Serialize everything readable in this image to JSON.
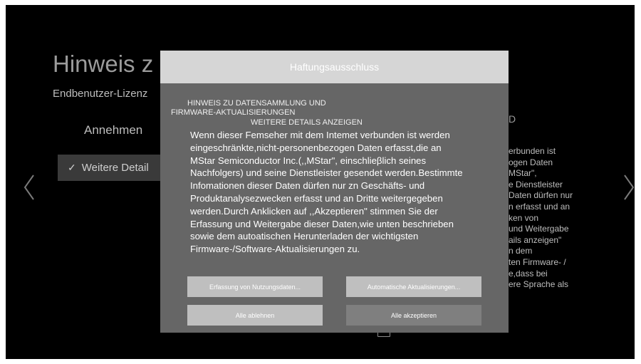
{
  "background": {
    "title": "Hinweis z",
    "subtitle": "Endbenutzer-Lizenz",
    "accept_option": "Annehmen",
    "more_details_option": "Weitere Detail",
    "right_panel_heading": "D",
    "right_panel_lines": [
      "erbunden ist",
      "ogen Daten",
      "MStar\",",
      "e Dienstleister",
      "Daten dürfen nur",
      "n erfasst und an",
      "ken von",
      "und Weitergabe",
      "ails anzeigen\"",
      "n dem",
      "ten Firmware- /",
      "e,dass bei",
      "ere Sprache als"
    ],
    "left_arrow_icon": "chevron-left-icon",
    "right_arrow_icon": "chevron-right-icon",
    "bottom_icon": "document-icon"
  },
  "modal": {
    "title": "Haftungsausschluss",
    "hinweis_lines": [
      "HINWEIS ZU DATENSAMMLUNG UND",
      "FIRMWARE-AKTUALISIERUNGEN"
    ],
    "more_details_link": "WEITERE DETAILS ANZEIGEN",
    "body_lines": [
      "Wenn dieser Femseher mit dem Intemet verbunden ist werden",
      "eingeschränkte,nicht-personenbezogen Daten erfasst,die an",
      "MStar Semiconductor Inc.(,,MStar\", einschlieβlich seines",
      "Nachfolgers) und seine Dienstleister gesendet werden.Bestimmte",
      "Infomationen dieser Daten dürfen nur zn Geschäfts- und",
      "Produktanalysezwecken erfasst und an Dritte weitergegeben",
      "werden.Durch Anklicken auf ,,Akzeptieren\" stimmen Sie der",
      "Erfassung und Weitergabe dieser Daten,wie unten beschrieben",
      "sowie dem autoatischen Herunterladen der wichtigsten",
      "Firmware-/Software-Aktualisierungen zu."
    ],
    "buttons": {
      "usage_data": "Erfassung von Nutzungsdaten...",
      "auto_updates": "Automatische Aktualisierungen...",
      "reject_all": "Alle ablehnen",
      "accept_all": "Alle akzeptieren"
    }
  },
  "colors": {
    "screen_bg": "#000000",
    "modal_bg": "#666666",
    "header_bg": "#d6d6d6",
    "button_light": "#bfbfbf",
    "button_dark": "#7f7f7f"
  }
}
